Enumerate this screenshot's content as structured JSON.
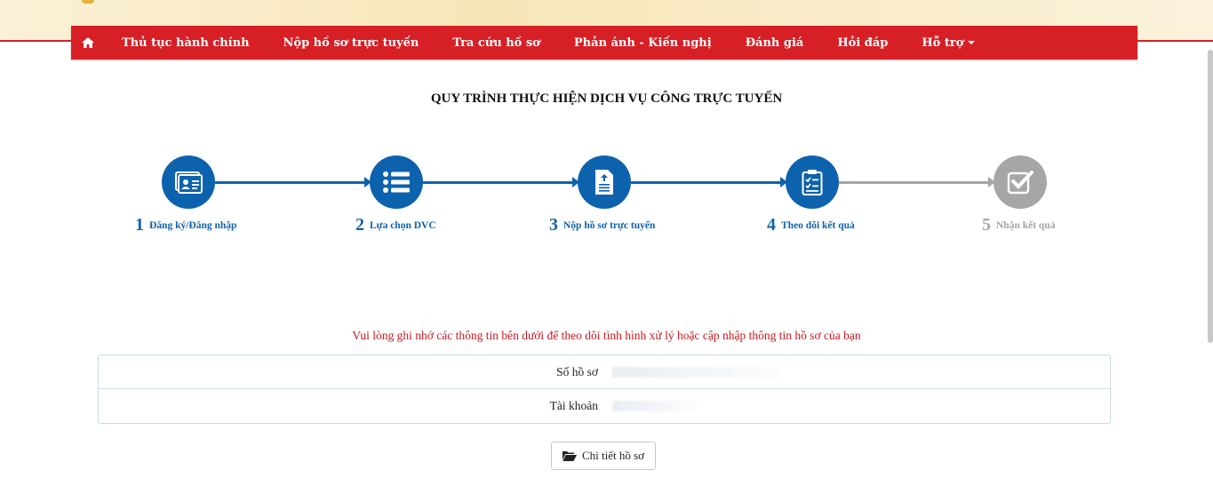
{
  "nav": {
    "items": [
      {
        "label": "Thủ tục hành chính"
      },
      {
        "label": "Nộp hồ sơ trực tuyến"
      },
      {
        "label": "Tra cứu hồ sơ"
      },
      {
        "label": "Phản ánh - Kiến nghị"
      },
      {
        "label": "Đánh giá"
      },
      {
        "label": "Hỏi đáp"
      },
      {
        "label": "Hỗ trợ"
      }
    ]
  },
  "title": "QUY TRÌNH THỰC HIỆN DỊCH VỤ CÔNG TRỰC TUYẾN",
  "steps": [
    {
      "num": "1",
      "label": "Đăng ký/Đăng nhập",
      "icon": "id-card-icon"
    },
    {
      "num": "2",
      "label": "Lựa chọn DVC",
      "icon": "list-icon"
    },
    {
      "num": "3",
      "label": "Nộp hồ sơ trực tuyến",
      "icon": "file-upload-icon"
    },
    {
      "num": "4",
      "label": "Theo dõi kết quả",
      "icon": "clipboard-check-icon"
    },
    {
      "num": "5",
      "label": "Nhận kết quả",
      "icon": "checkbox-icon"
    }
  ],
  "notice": "Vui lòng ghi nhớ các thông tin bên dưới để theo dõi tình hình xử lý hoặc cập nhập thông tin hồ sơ của bạn",
  "info": {
    "dossier_label": "Số hồ sơ",
    "account_label": "Tài khoản"
  },
  "detail_button": "Chi tiết hồ sơ",
  "colors": {
    "nav_bg": "#d71f26",
    "step_active": "#0d62ad",
    "step_inactive": "#a6a6a6",
    "notice": "#c8191f"
  }
}
